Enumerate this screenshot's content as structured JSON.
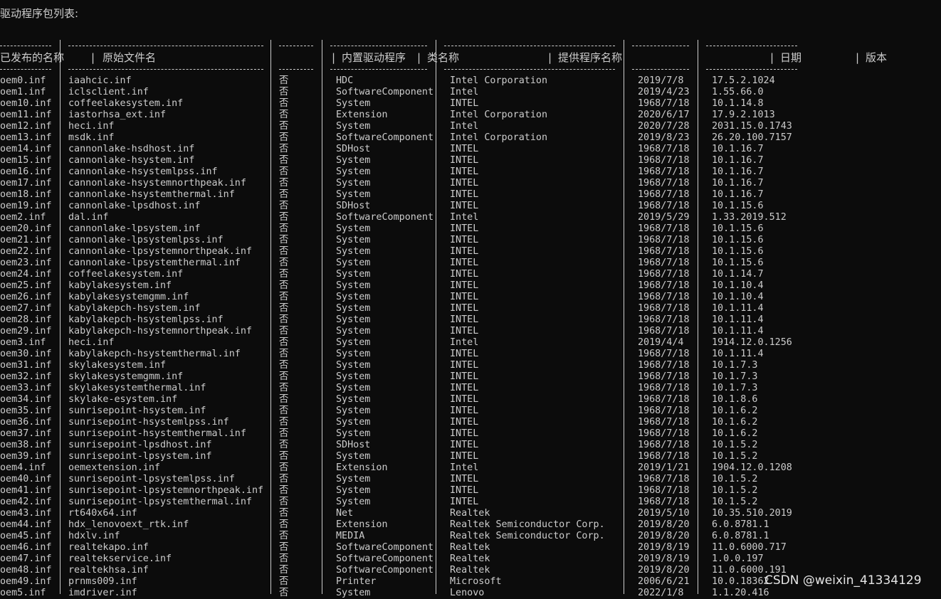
{
  "title": "驱动程序包列表:",
  "headers": {
    "published_name": "已发布的名称",
    "original_file": "原始文件名",
    "inbox": "内置驱动程序",
    "class_name": "类名称",
    "provider": "提供程序名称",
    "date": "日期",
    "version": "版本"
  },
  "rows": [
    [
      "oem0.inf",
      "iaahcic.inf",
      "否",
      "HDC",
      "Intel Corporation",
      "2019/7/8",
      "17.5.2.1024"
    ],
    [
      "oem1.inf",
      "iclsclient.inf",
      "否",
      "SoftwareComponent",
      "Intel",
      "2019/4/23",
      "1.55.66.0"
    ],
    [
      "oem10.inf",
      "coffeelakesystem.inf",
      "否",
      "System",
      "INTEL",
      "1968/7/18",
      "10.1.14.8"
    ],
    [
      "oem11.inf",
      "iastorhsa_ext.inf",
      "否",
      "Extension",
      "Intel Corporation",
      "2020/6/17",
      "17.9.2.1013"
    ],
    [
      "oem12.inf",
      "heci.inf",
      "否",
      "System",
      "Intel",
      "2020/7/28",
      "2031.15.0.1743"
    ],
    [
      "oem13.inf",
      "msdk.inf",
      "否",
      "SoftwareComponent",
      "Intel Corporation",
      "2019/8/23",
      "26.20.100.7157"
    ],
    [
      "oem14.inf",
      "cannonlake-hsdhost.inf",
      "否",
      "SDHost",
      "INTEL",
      "1968/7/18",
      "10.1.16.7"
    ],
    [
      "oem15.inf",
      "cannonlake-hsystem.inf",
      "否",
      "System",
      "INTEL",
      "1968/7/18",
      "10.1.16.7"
    ],
    [
      "oem16.inf",
      "cannonlake-hsystemlpss.inf",
      "否",
      "System",
      "INTEL",
      "1968/7/18",
      "10.1.16.7"
    ],
    [
      "oem17.inf",
      "cannonlake-hsystemnorthpeak.inf",
      "否",
      "System",
      "INTEL",
      "1968/7/18",
      "10.1.16.7"
    ],
    [
      "oem18.inf",
      "cannonlake-hsystemthermal.inf",
      "否",
      "System",
      "INTEL",
      "1968/7/18",
      "10.1.16.7"
    ],
    [
      "oem19.inf",
      "cannonlake-lpsdhost.inf",
      "否",
      "SDHost",
      "INTEL",
      "1968/7/18",
      "10.1.15.6"
    ],
    [
      "oem2.inf",
      "dal.inf",
      "否",
      "SoftwareComponent",
      "Intel",
      "2019/5/29",
      "1.33.2019.512"
    ],
    [
      "oem20.inf",
      "cannonlake-lpsystem.inf",
      "否",
      "System",
      "INTEL",
      "1968/7/18",
      "10.1.15.6"
    ],
    [
      "oem21.inf",
      "cannonlake-lpsystemlpss.inf",
      "否",
      "System",
      "INTEL",
      "1968/7/18",
      "10.1.15.6"
    ],
    [
      "oem22.inf",
      "cannonlake-lpsystemnorthpeak.inf",
      "否",
      "System",
      "INTEL",
      "1968/7/18",
      "10.1.15.6"
    ],
    [
      "oem23.inf",
      "cannonlake-lpsystemthermal.inf",
      "否",
      "System",
      "INTEL",
      "1968/7/18",
      "10.1.15.6"
    ],
    [
      "oem24.inf",
      "coffeelakesystem.inf",
      "否",
      "System",
      "INTEL",
      "1968/7/18",
      "10.1.14.7"
    ],
    [
      "oem25.inf",
      "kabylakesystem.inf",
      "否",
      "System",
      "INTEL",
      "1968/7/18",
      "10.1.10.4"
    ],
    [
      "oem26.inf",
      "kabylakesystemgmm.inf",
      "否",
      "System",
      "INTEL",
      "1968/7/18",
      "10.1.10.4"
    ],
    [
      "oem27.inf",
      "kabylakepch-hsystem.inf",
      "否",
      "System",
      "INTEL",
      "1968/7/18",
      "10.1.11.4"
    ],
    [
      "oem28.inf",
      "kabylakepch-hsystemlpss.inf",
      "否",
      "System",
      "INTEL",
      "1968/7/18",
      "10.1.11.4"
    ],
    [
      "oem29.inf",
      "kabylakepch-hsystemnorthpeak.inf",
      "否",
      "System",
      "INTEL",
      "1968/7/18",
      "10.1.11.4"
    ],
    [
      "oem3.inf",
      "heci.inf",
      "否",
      "System",
      "Intel",
      "2019/4/4",
      "1914.12.0.1256"
    ],
    [
      "oem30.inf",
      "kabylakepch-hsystemthermal.inf",
      "否",
      "System",
      "INTEL",
      "1968/7/18",
      "10.1.11.4"
    ],
    [
      "oem31.inf",
      "skylakesystem.inf",
      "否",
      "System",
      "INTEL",
      "1968/7/18",
      "10.1.7.3"
    ],
    [
      "oem32.inf",
      "skylakesystemgmm.inf",
      "否",
      "System",
      "INTEL",
      "1968/7/18",
      "10.1.7.3"
    ],
    [
      "oem33.inf",
      "skylakesystemthermal.inf",
      "否",
      "System",
      "INTEL",
      "1968/7/18",
      "10.1.7.3"
    ],
    [
      "oem34.inf",
      "skylake-esystem.inf",
      "否",
      "System",
      "INTEL",
      "1968/7/18",
      "10.1.8.6"
    ],
    [
      "oem35.inf",
      "sunrisepoint-hsystem.inf",
      "否",
      "System",
      "INTEL",
      "1968/7/18",
      "10.1.6.2"
    ],
    [
      "oem36.inf",
      "sunrisepoint-hsystemlpss.inf",
      "否",
      "System",
      "INTEL",
      "1968/7/18",
      "10.1.6.2"
    ],
    [
      "oem37.inf",
      "sunrisepoint-hsystemthermal.inf",
      "否",
      "System",
      "INTEL",
      "1968/7/18",
      "10.1.6.2"
    ],
    [
      "oem38.inf",
      "sunrisepoint-lpsdhost.inf",
      "否",
      "SDHost",
      "INTEL",
      "1968/7/18",
      "10.1.5.2"
    ],
    [
      "oem39.inf",
      "sunrisepoint-lpsystem.inf",
      "否",
      "System",
      "INTEL",
      "1968/7/18",
      "10.1.5.2"
    ],
    [
      "oem4.inf",
      "oemextension.inf",
      "否",
      "Extension",
      "Intel",
      "2019/1/21",
      "1904.12.0.1208"
    ],
    [
      "oem40.inf",
      "sunrisepoint-lpsystemlpss.inf",
      "否",
      "System",
      "INTEL",
      "1968/7/18",
      "10.1.5.2"
    ],
    [
      "oem41.inf",
      "sunrisepoint-lpsystemnorthpeak.inf",
      "否",
      "System",
      "INTEL",
      "1968/7/18",
      "10.1.5.2"
    ],
    [
      "oem42.inf",
      "sunrisepoint-lpsystemthermal.inf",
      "否",
      "System",
      "INTEL",
      "1968/7/18",
      "10.1.5.2"
    ],
    [
      "oem43.inf",
      "rt640x64.inf",
      "否",
      "Net",
      "Realtek",
      "2019/5/10",
      "10.35.510.2019"
    ],
    [
      "oem44.inf",
      "hdx_lenovoext_rtk.inf",
      "否",
      "Extension",
      "Realtek Semiconductor Corp.",
      "2019/8/20",
      "6.0.8781.1"
    ],
    [
      "oem45.inf",
      "hdxlv.inf",
      "否",
      "MEDIA",
      "Realtek Semiconductor Corp.",
      "2019/8/20",
      "6.0.8781.1"
    ],
    [
      "oem46.inf",
      "realtekapo.inf",
      "否",
      "SoftwareComponent",
      "Realtek",
      "2019/8/19",
      "11.0.6000.717"
    ],
    [
      "oem47.inf",
      "realtekservice.inf",
      "否",
      "SoftwareComponent",
      "Realtek",
      "2019/8/19",
      "1.0.0.197"
    ],
    [
      "oem48.inf",
      "realtekhsa.inf",
      "否",
      "SoftwareComponent",
      "Realtek",
      "2019/8/20",
      "11.0.6000.191"
    ],
    [
      "oem49.inf",
      "prnms009.inf",
      "否",
      "Printer",
      "Microsoft",
      "2006/6/21",
      "10.0.18362"
    ],
    [
      "oem5.inf",
      "imdriver.inf",
      "否",
      "System",
      "Lenovo",
      "2022/1/8",
      "1.1.20.416"
    ]
  ],
  "watermark": "CSDN @weixin_41334129"
}
